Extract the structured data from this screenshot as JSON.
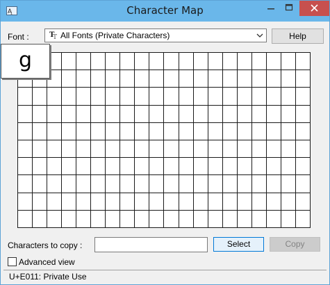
{
  "window": {
    "title": "Character Map"
  },
  "font": {
    "label": "Font :",
    "value": "All Fonts (Private Characters)"
  },
  "help_label": "Help",
  "grid": {
    "columns": 20,
    "rows": 10
  },
  "magnified_glyph": "g",
  "copy": {
    "label": "Characters to copy :",
    "value": "",
    "select_label": "Select",
    "copy_label": "Copy"
  },
  "advanced": {
    "label": "Advanced view",
    "checked": false
  },
  "status": {
    "text": "U+E011: Private Use"
  },
  "icons": {
    "app": "character-map-icon",
    "font_type": "truetype-font-icon",
    "dropdown": "chevron-down-icon",
    "minimize": "minimize-icon",
    "maximize": "maximize-icon",
    "close": "close-icon"
  },
  "colors": {
    "titlebar": "#6ab7ea",
    "close_button": "#c7504e",
    "select_border": "#0078d7"
  }
}
